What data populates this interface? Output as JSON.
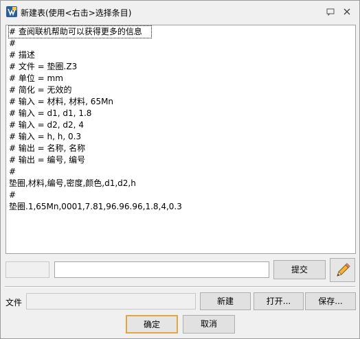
{
  "window": {
    "title": "新建表(使用<右击>选择条目)",
    "help_icon": "help-bubble-icon",
    "close_icon": "close-icon"
  },
  "editor": {
    "lines": [
      "# 查阅联机帮助可以获得更多的信息",
      "#",
      "# 描述",
      "# 文件 = 垫圈.Z3",
      "# 单位 = mm",
      "# 简化 = 无效的",
      "# 输入 = 材料, 材料, 65Mn",
      "# 输入 = d1, d1, 1.8",
      "# 输入 = d2, d2, 4",
      "# 输入 = h, h, 0.3",
      "# 输出 = 名称, 名称",
      "# 输出 = 编号, 编号",
      "#",
      "垫圈,材料,编号,密度,颜色,d1,d2,h",
      "#",
      "垫圈.1,65Mn,0001,7.81,96.96.96,1.8,4,0.3"
    ]
  },
  "submit_row": {
    "name_value": "",
    "value_input": "",
    "submit_label": "提交",
    "pencil_icon": "pencil-icon"
  },
  "file_row": {
    "label": "文件",
    "path_value": "",
    "new_label": "新建",
    "open_label": "打开...",
    "save_label": "保存..."
  },
  "footer": {
    "ok_label": "确定",
    "cancel_label": "取消"
  }
}
